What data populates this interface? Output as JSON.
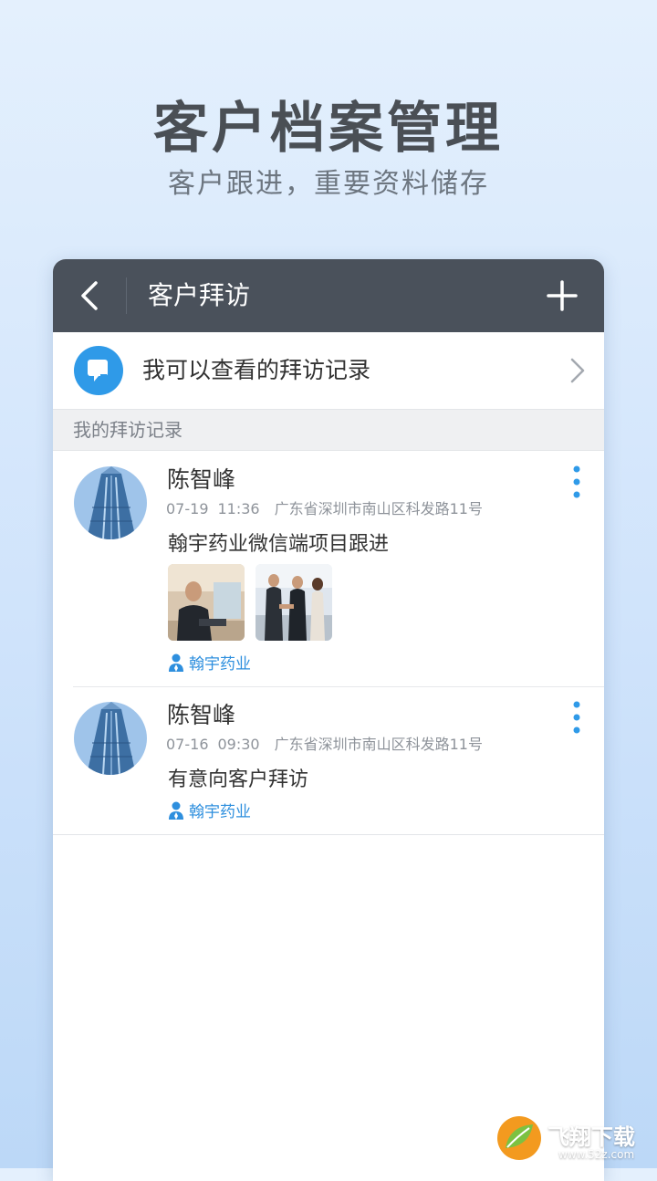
{
  "promo": {
    "title": "客户档案管理",
    "subtitle": "客户跟进，重要资料储存"
  },
  "appbar": {
    "title": "客户拜访",
    "back_icon": "chevron-left-icon",
    "add_icon": "plus-icon"
  },
  "entry": {
    "label": "我可以查看的拜访记录",
    "icon": "chat-bubble-icon",
    "chevron_icon": "chevron-right-icon"
  },
  "section": {
    "title": "我的拜访记录"
  },
  "records": [
    {
      "name": "陈智峰",
      "date": "07-19",
      "time": "11:36",
      "address": "广东省深圳市南山区科发路11号",
      "content": "翰宇药业微信端项目跟进",
      "photos": 2,
      "tag": "翰宇药业"
    },
    {
      "name": "陈智峰",
      "date": "07-16",
      "time": "09:30",
      "address": "广东省深圳市南山区科发路11号",
      "content": "有意向客户拜访",
      "photos": 0,
      "tag": "翰宇药业"
    }
  ],
  "watermark": {
    "text": "飞翔下载",
    "url": "www.52z.com"
  },
  "colors": {
    "appbar": "#4a515b",
    "accent": "#2f9ae8",
    "tag": "#2e8fde"
  }
}
